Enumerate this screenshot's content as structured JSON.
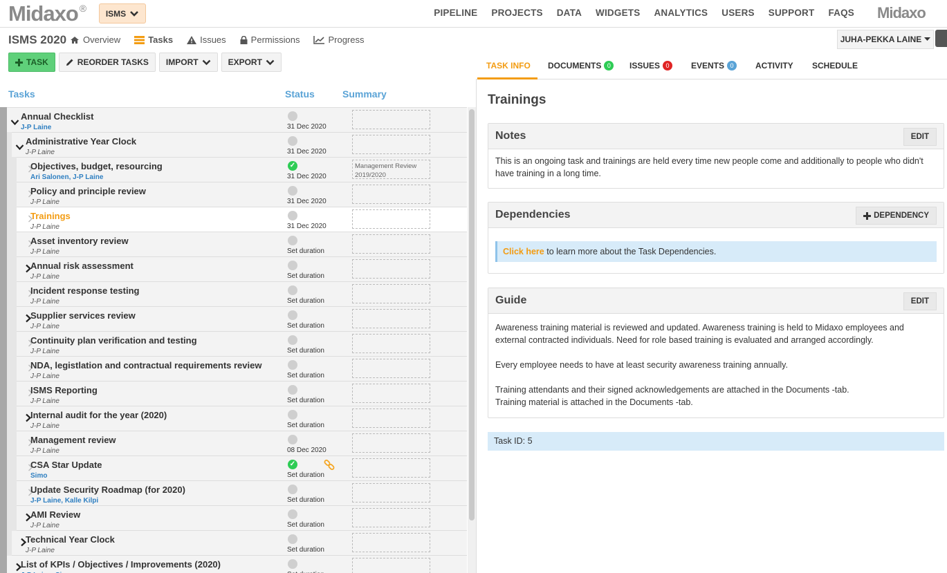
{
  "brand": {
    "logo": "Midaxo",
    "mark": "®"
  },
  "app_switch": {
    "label": "ISMS"
  },
  "nav": [
    "PIPELINE",
    "PROJECTS",
    "DATA",
    "WIDGETS",
    "ANALYTICS",
    "USERS",
    "SUPPORT",
    "FAQS"
  ],
  "project": {
    "title": "ISMS 2020",
    "subnav": [
      {
        "label": "Overview",
        "icon": "home-icon"
      },
      {
        "label": "Tasks",
        "icon": "list-icon",
        "active": true
      },
      {
        "label": "Issues",
        "icon": "warning-icon"
      },
      {
        "label": "Permissions",
        "icon": "lock-icon"
      },
      {
        "label": "Progress",
        "icon": "chart-icon"
      }
    ],
    "user": "JUHA-PEKKA LAINE"
  },
  "toolbar": {
    "task": "TASK",
    "reorder": "REORDER TASKS",
    "import": "IMPORT",
    "export": "EXPORT"
  },
  "columns": {
    "tasks": "Tasks",
    "status": "Status",
    "summary": "Summary"
  },
  "tasks": [
    {
      "name": "Annual Checklist",
      "assignee": "J-P Laine",
      "assignee_link": true,
      "due": "31 Dec 2020",
      "level": 0,
      "expander": "open",
      "done": false,
      "summary": ""
    },
    {
      "name": "Administrative Year Clock",
      "assignee": "J-P Laine",
      "assignee_link": false,
      "due": "31 Dec 2020",
      "level": 1,
      "expander": "open",
      "done": false,
      "summary": ""
    },
    {
      "name": "Objectives, budget, resourcing",
      "assignee": "Ari Salonen, J-P Laine",
      "assignee_link": true,
      "due": "31 Dec 2020",
      "level": 2,
      "expander": "leaf",
      "done": true,
      "summary": "Management Review 2019/2020"
    },
    {
      "name": "Policy and principle review",
      "assignee": "J-P Laine",
      "assignee_link": false,
      "due": "31 Dec 2020",
      "level": 2,
      "expander": "leaf",
      "done": false,
      "summary": ""
    },
    {
      "name": "Trainings",
      "assignee": "J-P Laine",
      "assignee_link": false,
      "due": "31 Dec 2020",
      "level": 2,
      "expander": "leaf",
      "done": false,
      "summary": "",
      "selected": true
    },
    {
      "name": "Asset inventory review",
      "assignee": "J-P Laine",
      "assignee_link": false,
      "due": "Set duration",
      "level": 2,
      "expander": "leaf",
      "done": false,
      "summary": ""
    },
    {
      "name": "Annual risk assessment",
      "assignee": "J-P Laine",
      "assignee_link": false,
      "due": "Set duration",
      "level": 2,
      "expander": "closed",
      "done": false,
      "summary": ""
    },
    {
      "name": "Incident response testing",
      "assignee": "J-P Laine",
      "assignee_link": false,
      "due": "Set duration",
      "level": 2,
      "expander": "leaf",
      "done": false,
      "summary": ""
    },
    {
      "name": "Supplier services review",
      "assignee": "J-P Laine",
      "assignee_link": false,
      "due": "Set duration",
      "level": 2,
      "expander": "closed",
      "done": false,
      "summary": ""
    },
    {
      "name": "Continuity plan verification and testing",
      "assignee": "J-P Laine",
      "assignee_link": false,
      "due": "Set duration",
      "level": 2,
      "expander": "leaf",
      "done": false,
      "summary": ""
    },
    {
      "name": "NDA, legistlation and contractual requirements review",
      "assignee": "J-P Laine",
      "assignee_link": false,
      "due": "Set duration",
      "level": 2,
      "expander": "leaf",
      "done": false,
      "summary": ""
    },
    {
      "name": "ISMS Reporting",
      "assignee": "J-P Laine",
      "assignee_link": false,
      "due": "Set duration",
      "level": 2,
      "expander": "leaf",
      "done": false,
      "summary": ""
    },
    {
      "name": "Internal audit for the year (2020)",
      "assignee": "J-P Laine",
      "assignee_link": false,
      "due": "Set duration",
      "level": 2,
      "expander": "closed",
      "done": false,
      "summary": ""
    },
    {
      "name": "Management review",
      "assignee": "J-P Laine",
      "assignee_link": false,
      "due": "08 Dec 2020",
      "level": 2,
      "expander": "leaf",
      "done": false,
      "summary": ""
    },
    {
      "name": "CSA Star Update",
      "assignee": "Simo",
      "assignee_link": true,
      "due": "Set duration",
      "level": 2,
      "expander": "leaf",
      "done": true,
      "summary": "",
      "link_icon": true
    },
    {
      "name": "Update Security Roadmap (for 2020)",
      "assignee": "J-P Laine, Kalle Kilpi",
      "assignee_link": true,
      "due": "Set duration",
      "level": 2,
      "expander": "leaf",
      "done": false,
      "summary": ""
    },
    {
      "name": "AMI Review",
      "assignee": "J-P Laine",
      "assignee_link": false,
      "due": "Set duration",
      "level": 2,
      "expander": "closed",
      "done": false,
      "summary": ""
    },
    {
      "name": "Technical Year Clock",
      "assignee": "J-P Laine",
      "assignee_link": false,
      "due": "Set duration",
      "level": 1,
      "expander": "closed",
      "done": false,
      "summary": ""
    },
    {
      "name": "List of KPIs / Objectives / Improvements (2020)",
      "assignee": "J-P Laine, Simo",
      "assignee_link": true,
      "due": "Set duration",
      "level": 0,
      "expander": "closed",
      "done": false,
      "summary": ""
    }
  ],
  "tabs": [
    {
      "label": "TASK INFO",
      "active": true
    },
    {
      "label": "DOCUMENTS",
      "badge": "0",
      "badge_color": "green"
    },
    {
      "label": "ISSUES",
      "badge": "0",
      "badge_color": "red"
    },
    {
      "label": "EVENTS",
      "badge": "0",
      "badge_color": "blue"
    },
    {
      "label": "ACTIVITY"
    },
    {
      "label": "SCHEDULE"
    }
  ],
  "task_info": {
    "title": "Trainings",
    "notes": {
      "heading": "Notes",
      "edit": "EDIT",
      "text": "This is an ongoing task and trainings are held every time new people come and additionally to people who didn't have training in a long time."
    },
    "dependencies": {
      "heading": "Dependencies",
      "button": "DEPENDENCY",
      "link_text": "Click here",
      "text": "to learn more about the Task Dependencies."
    },
    "guide": {
      "heading": "Guide",
      "edit": "EDIT",
      "paragraphs": [
        "Awareness training material is reviewed and updated. Awareness training is held to Midaxo employees and external contracted individuals. Need for role based training is evaluated and arranged accordingly.",
        "Every employee needs to have at least security awareness training annually.",
        "Training attendants and their signed acknowledgements are attached in the Documents -tab.\nTraining material is attached in the Documents -tab."
      ]
    },
    "task_id": "Task ID: 5"
  },
  "colors": {
    "accent": "#f39c12",
    "link": "#2e7fc1",
    "header_blue": "#5aa3d6",
    "done_green": "#2ecc55"
  }
}
